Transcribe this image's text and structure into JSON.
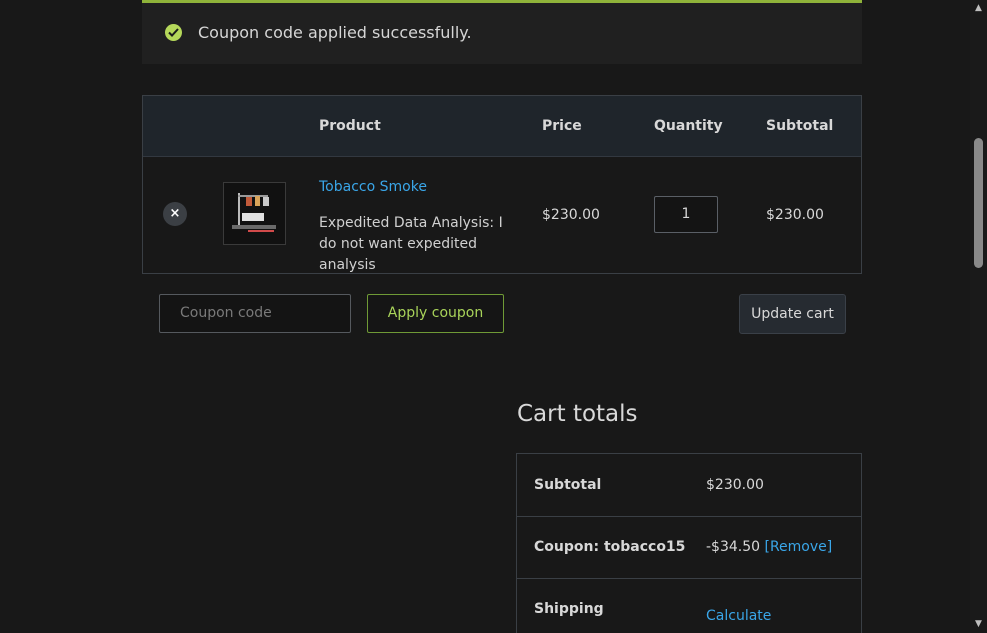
{
  "notice": {
    "icon": "check-circle-icon",
    "text": "Coupon code applied successfully."
  },
  "cart": {
    "columns": [
      "Product",
      "Price",
      "Quantity",
      "Subtotal"
    ],
    "item": {
      "remove_icon": "×",
      "name": "Tobacco Smoke",
      "meta": "Expedited Data Analysis: I do not want expedited analysis",
      "price": "$230.00",
      "quantity": "1",
      "subtotal": "$230.00"
    }
  },
  "coupon": {
    "placeholder": "Coupon code",
    "apply_label": "Apply coupon",
    "update_label": "Update cart"
  },
  "totals": {
    "title": "Cart totals",
    "subtotal_label": "Subtotal",
    "subtotal_value": "$230.00",
    "coupon_label": "Coupon: tobacco15",
    "coupon_value": "-$34.50",
    "coupon_remove": "[Remove]",
    "shipping_label": "Shipping",
    "shipping_link": "Calculate shipping"
  },
  "colors": {
    "accent_green": "#8fb33a",
    "link_blue": "#3aa6e8",
    "background": "#181818"
  }
}
